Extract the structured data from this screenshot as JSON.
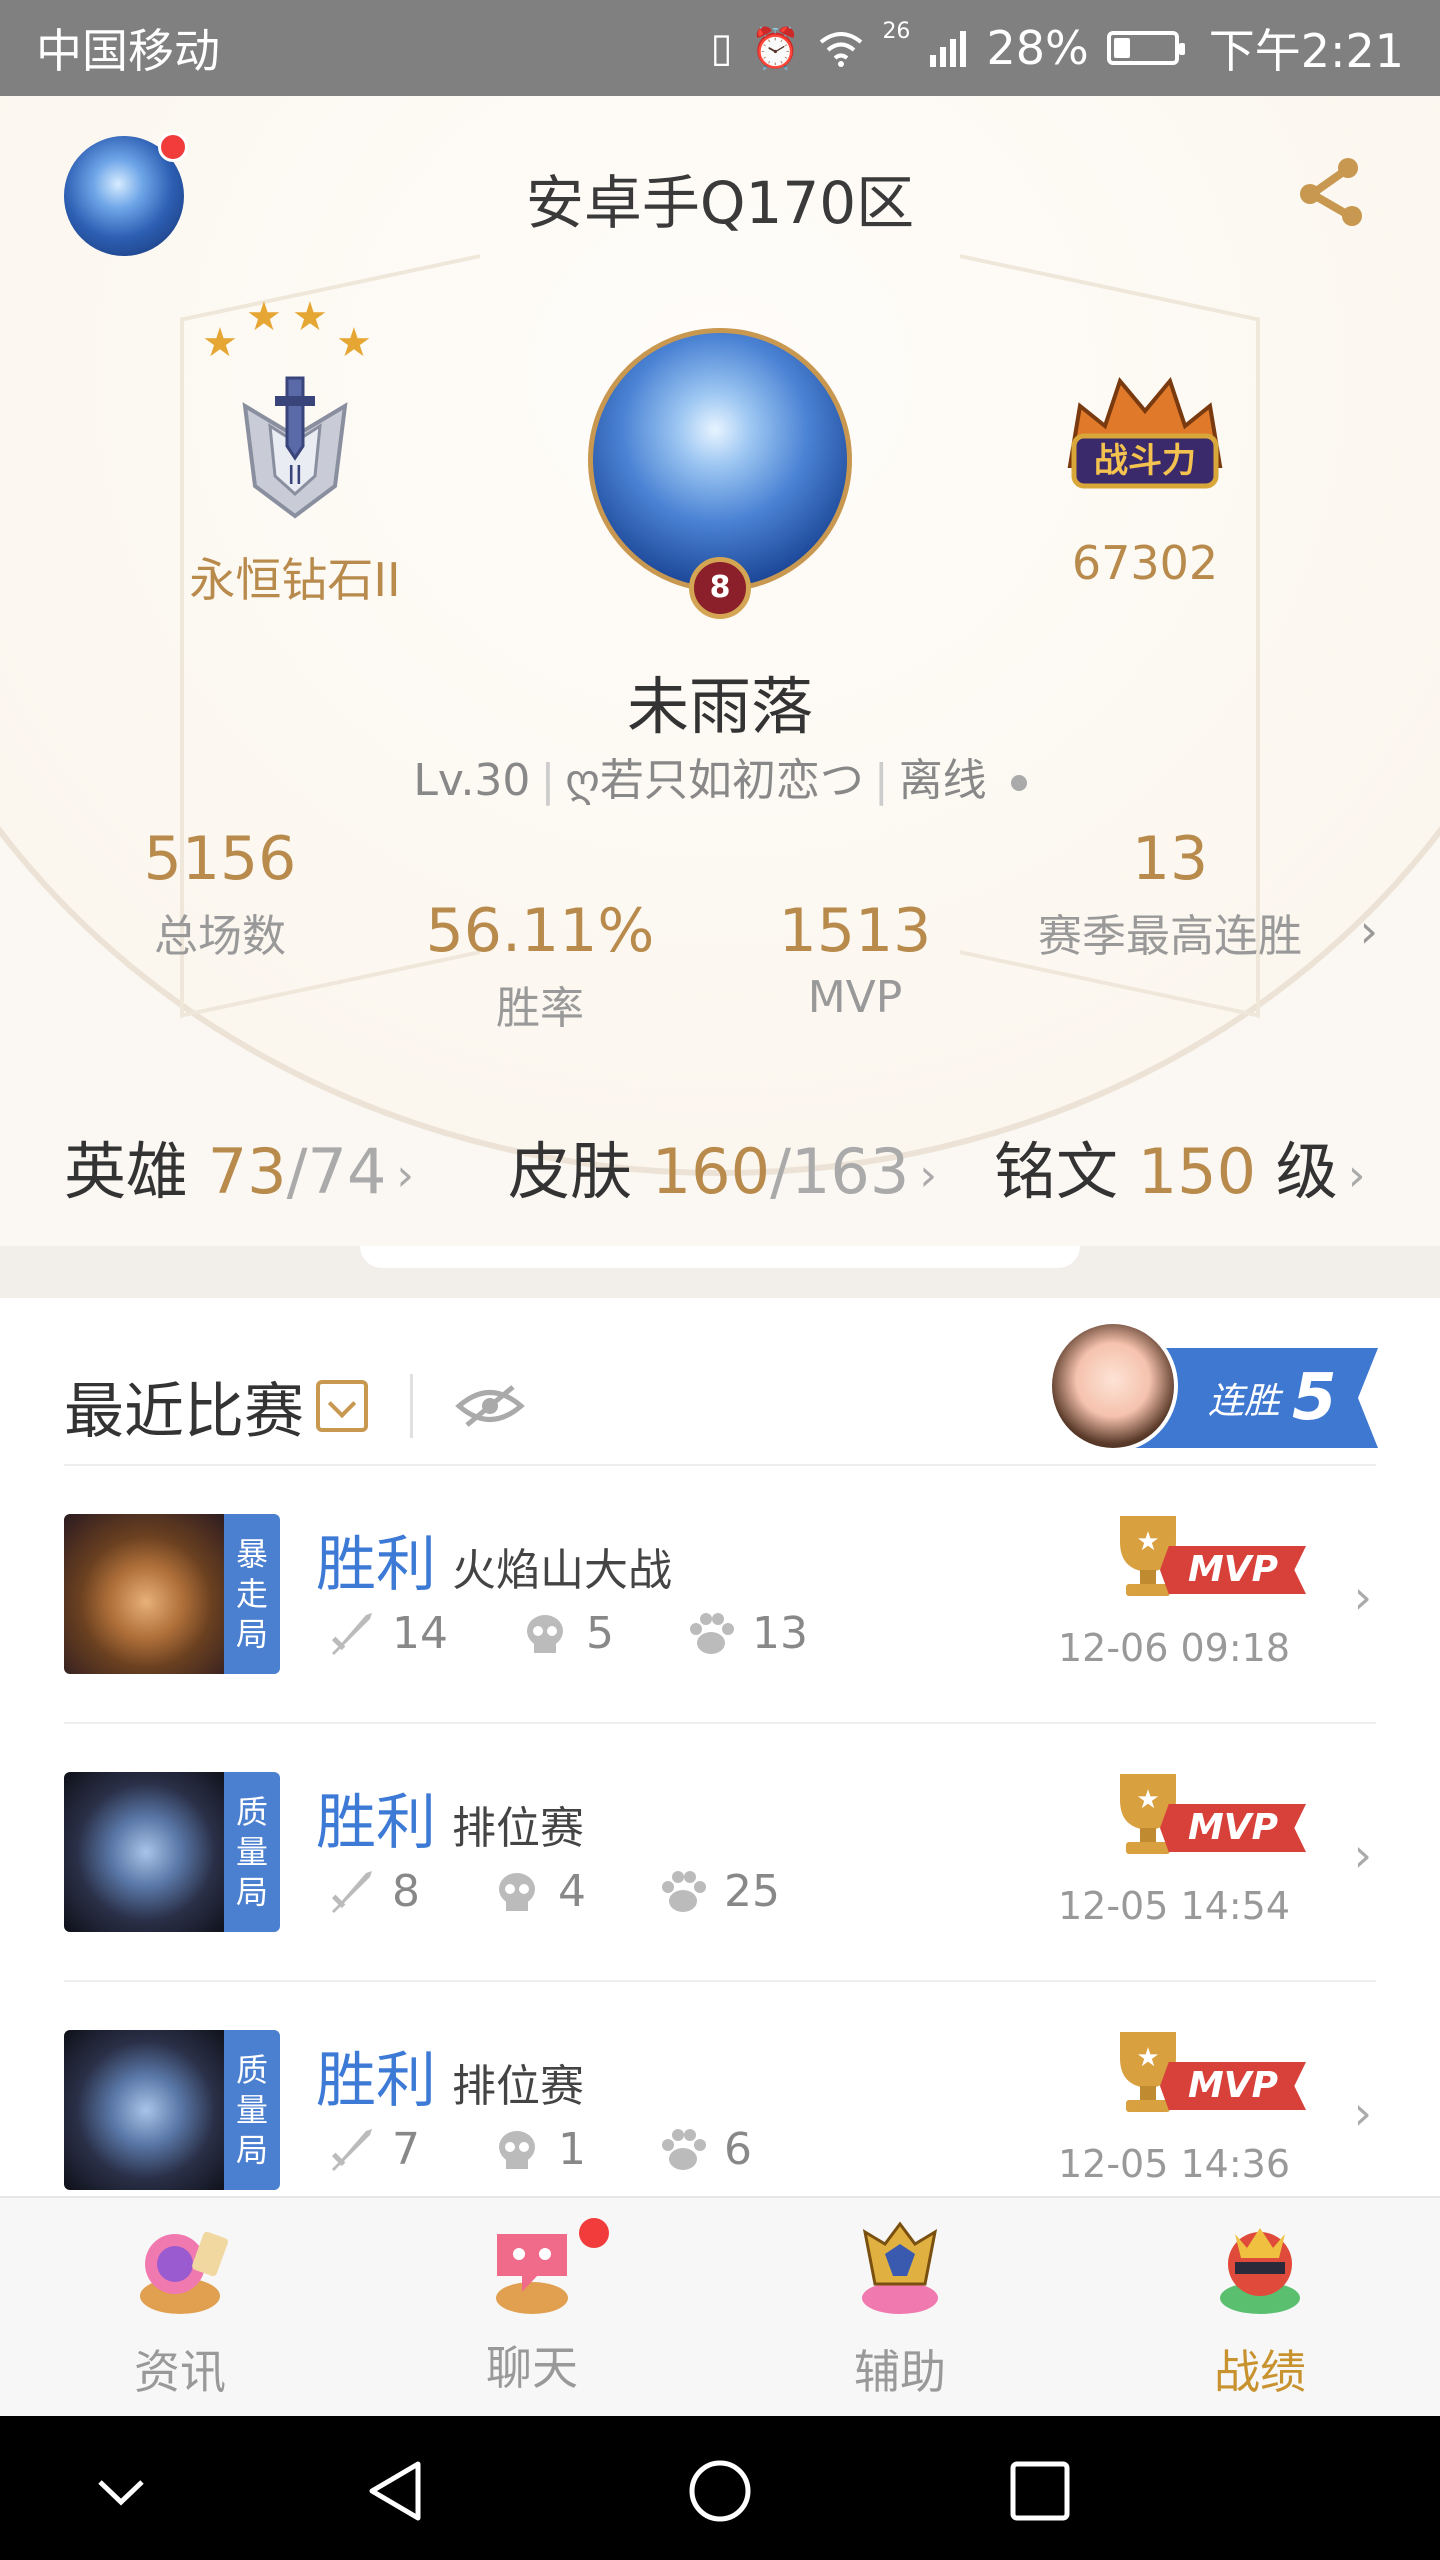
{
  "status_bar": {
    "carrier": "中国移动",
    "network": "26",
    "battery": "28%",
    "battery_level": 0.28,
    "time": "下午2:21"
  },
  "profile": {
    "server": "安卓手Q170区",
    "rank": "永恒钻石II",
    "rank_stars": 4,
    "avatar_level": "8",
    "combat_power": "67302",
    "nickname": "未雨落",
    "level": "Lv.30",
    "signature": "ღ若只如初恋つ",
    "online_status": "离线"
  },
  "stats": {
    "total_games": {
      "value": "5156",
      "label": "总场数"
    },
    "win_rate": {
      "value": "56.11%",
      "label": "胜率"
    },
    "mvp": {
      "value": "1513",
      "label": "MVP"
    },
    "season_best_streak": {
      "value": "13",
      "label": "赛季最高连胜"
    }
  },
  "collection": {
    "heroes": {
      "label": "英雄",
      "owned": "73",
      "total": "/74"
    },
    "skins": {
      "label": "皮肤",
      "owned": "160",
      "total": "/163"
    },
    "inscription": {
      "label": "铭文",
      "level": "150",
      "unit": "级"
    }
  },
  "recent": {
    "title": "最近比赛",
    "streak_label": "连胜",
    "streak_count": "5",
    "matches": [
      {
        "mode": [
          "暴",
          "走",
          "局"
        ],
        "result": "胜利",
        "type": "火焰山大战",
        "kills": "14",
        "deaths": "5",
        "assists": "13",
        "mvp": "MVP",
        "time": "12-06 09:18"
      },
      {
        "mode": [
          "质",
          "量",
          "局"
        ],
        "result": "胜利",
        "type": "排位赛",
        "kills": "8",
        "deaths": "4",
        "assists": "25",
        "mvp": "MVP",
        "time": "12-05 14:54"
      },
      {
        "mode": [
          "质",
          "量",
          "局"
        ],
        "result": "胜利",
        "type": "排位赛",
        "kills": "7",
        "deaths": "1",
        "assists": "6",
        "mvp": "MVP",
        "time": "12-05 14:36"
      }
    ]
  },
  "tabs": [
    {
      "label": "资讯",
      "icon": "news-icon",
      "active": false
    },
    {
      "label": "聊天",
      "icon": "chat-icon",
      "active": false
    },
    {
      "label": "辅助",
      "icon": "assist-icon",
      "active": false
    },
    {
      "label": "战绩",
      "icon": "record-icon",
      "active": true
    }
  ],
  "colors": {
    "gold": "#b88a4c",
    "win_blue": "#3d7ad6",
    "active_tab": "#c8922e",
    "mvp_red": "#d8403a"
  }
}
